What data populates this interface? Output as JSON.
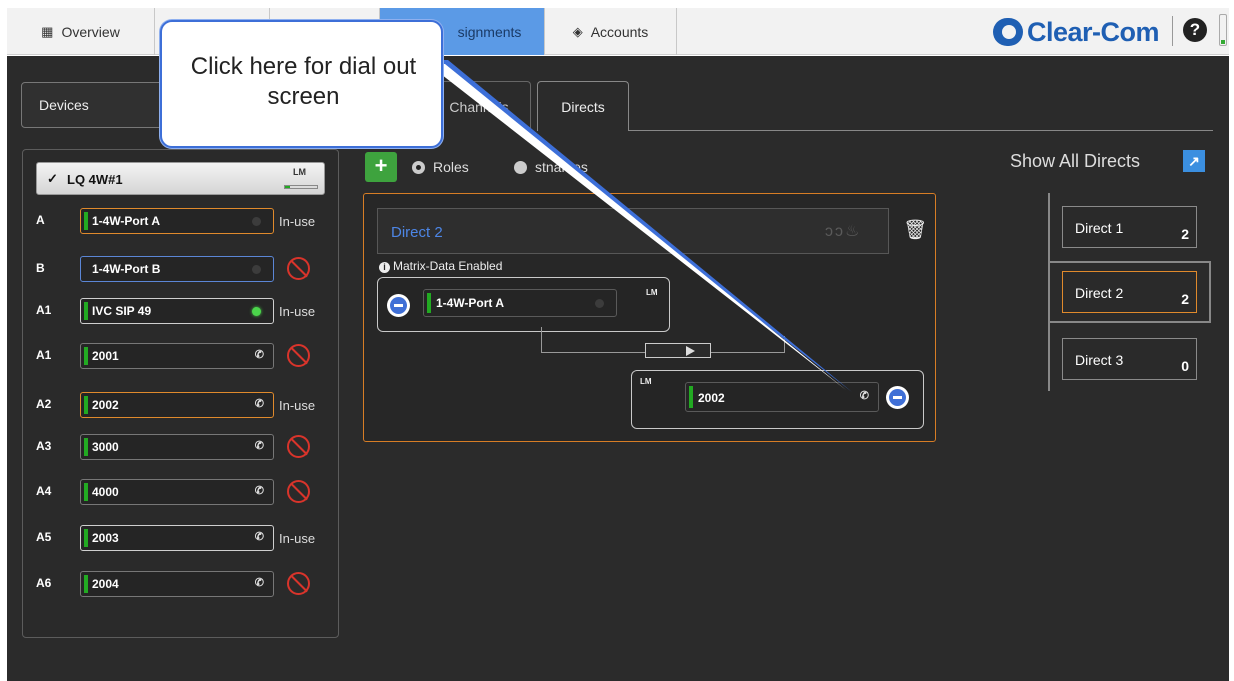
{
  "nav": {
    "tabs": [
      {
        "label": "Overview",
        "icon": "grid-icon"
      },
      {
        "label": "",
        "icon": ""
      },
      {
        "label": "",
        "icon": ""
      },
      {
        "label": "signments",
        "icon": ""
      },
      {
        "label": "Accounts",
        "icon": "globe-icon"
      }
    ],
    "logo": "Clear-Com",
    "help": "?"
  },
  "subtabs": {
    "devices": "Devices",
    "channels": "Channels",
    "directs": "Directs"
  },
  "device": {
    "name": "LQ 4W#1",
    "lm": "LM",
    "ports": [
      {
        "key": "A",
        "label": "1-4W-Port A",
        "status": "In-use",
        "indicator": "dot-off"
      },
      {
        "key": "B",
        "label": "1-4W-Port B",
        "status": "",
        "indicator": "dot-off"
      },
      {
        "key": "A1",
        "label": "IVC SIP 49",
        "status": "In-use",
        "indicator": "dot-on"
      },
      {
        "key": "A1",
        "label": "2001",
        "status": "",
        "indicator": "sip"
      },
      {
        "key": "A2",
        "label": "2002",
        "status": "In-use",
        "indicator": "sip"
      },
      {
        "key": "A3",
        "label": "3000",
        "status": "",
        "indicator": "sip"
      },
      {
        "key": "A4",
        "label": "4000",
        "status": "",
        "indicator": "sip"
      },
      {
        "key": "A5",
        "label": "2003",
        "status": "In-use",
        "indicator": "sip"
      },
      {
        "key": "A6",
        "label": "2004",
        "status": "",
        "indicator": "sip"
      }
    ]
  },
  "toolbar": {
    "add": "+",
    "roles": "Roles",
    "hostnames": "stnames",
    "show_all": "Show All Directs"
  },
  "direct": {
    "title": "Direct 2",
    "matrix": "Matrix-Data Enabled",
    "source_label": "1-4W-Port A",
    "source_lm": "LM",
    "dest_label": "2002",
    "dest_lm": "LM"
  },
  "directs_list": [
    {
      "name": "Direct 1",
      "count": "2"
    },
    {
      "name": "Direct 2",
      "count": "2"
    },
    {
      "name": "Direct 3",
      "count": "0"
    }
  ],
  "callout": {
    "text": "Click here for dial out screen"
  },
  "colors": {
    "accent": "#5b9ae6",
    "selected_border": "#e08a2c",
    "title_blue": "#4d86e6",
    "add_green": "#3ea33e",
    "no_entry_red": "#d9342b"
  }
}
